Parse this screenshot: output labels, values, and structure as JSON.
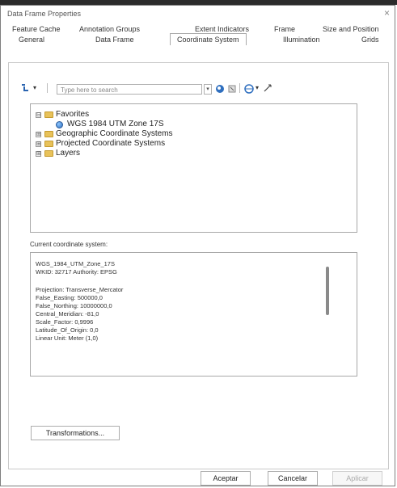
{
  "dialog": {
    "title": "Data Frame Properties",
    "close_glyph": "×"
  },
  "tabs_row1": [
    "Feature Cache",
    "Annotation Groups",
    "Extent Indicators",
    "Frame",
    "Size and Position"
  ],
  "tabs_row2": [
    "General",
    "Data Frame",
    "Coordinate System",
    "Illumination",
    "Grids"
  ],
  "active_tab": "Coordinate System",
  "toolbar": {
    "search_placeholder": "Type here to search",
    "icons": [
      "filter-icon",
      "search-icon",
      "globe-icon",
      "add-icon"
    ]
  },
  "tree": {
    "items": [
      {
        "label": "Favorites",
        "expander": "⊟",
        "icon": "folder-icon"
      },
      {
        "label": "WGS 1984 UTM Zone 17S",
        "icon": "globe-icon"
      },
      {
        "label": "Geographic Coordinate Systems",
        "expander": "⊞",
        "icon": "folder-icon"
      },
      {
        "label": "Projected Coordinate Systems",
        "expander": "⊞",
        "icon": "folder-icon"
      },
      {
        "label": "Layers",
        "expander": "⊞",
        "icon": "folder-icon"
      }
    ]
  },
  "current": {
    "label": "Current coordinate system:",
    "lines": [
      "WGS_1984_UTM_Zone_17S",
      "WKID: 32717 Authority: EPSG",
      "",
      "Projection: Transverse_Mercator",
      "False_Easting: 500000,0",
      "False_Northing: 10000000,0",
      "Central_Meridian: -81,0",
      "Scale_Factor: 0,9996",
      "Latitude_Of_Origin: 0,0",
      "Linear Unit: Meter (1,0)"
    ]
  },
  "buttons": {
    "transformations": "Transformations...",
    "ok": "Aceptar",
    "cancel": "Cancelar",
    "apply": "Aplicar"
  }
}
